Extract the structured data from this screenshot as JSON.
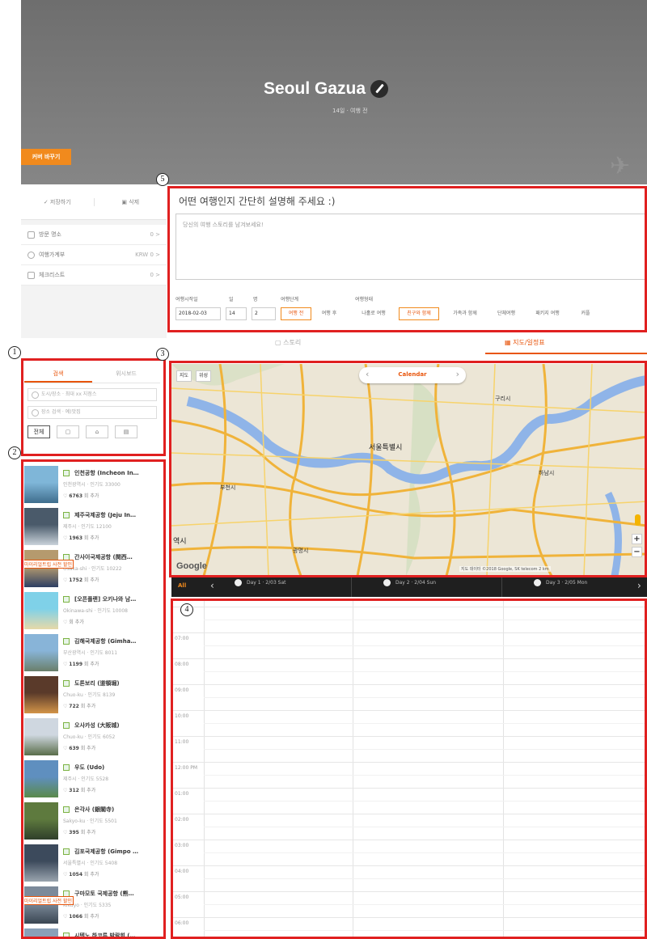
{
  "hero": {
    "title": "Seoul Gazua",
    "subtitle": "14일 · 여행 전",
    "cover_button": "커버 바꾸기"
  },
  "left_panel": {
    "save_button": "저장하기",
    "delete_button": "삭제",
    "menu": [
      {
        "label": "방문 명소",
        "count": "0 >"
      },
      {
        "label": "여행가계부",
        "count": "KRW 0 >"
      },
      {
        "label": "체크리스트",
        "count": "0 >"
      }
    ]
  },
  "search_panel": {
    "tabs": [
      "검색",
      "위시보드"
    ],
    "active_tab": 0,
    "city_placeholder": "도시/장소 · 최대 xx 지점스",
    "place_placeholder": "장소 검색 · 예)맛집",
    "filters": [
      "전체",
      "",
      "",
      ""
    ]
  },
  "places": [
    {
      "name": "인천공항 (Incheon In…",
      "sub": "인천광역시 · 인기도 33000",
      "count": "6763",
      "suffix": "회 추가",
      "colors": [
        "#7fb6d8",
        "#3f6d8c"
      ]
    },
    {
      "name": "제주국제공항 (Jeju In…",
      "sub": "제주시 · 인기도 12100",
      "count": "1963",
      "suffix": "회 추가",
      "colors": [
        "#4a5a6a",
        "#c9d2da"
      ]
    },
    {
      "name": "간사이국제공항 (関西…",
      "sub": "Osaka-shi · 인기도 10222",
      "count": "1752",
      "suffix": "회 추가",
      "tag": "마이리얼트립 사전 할인",
      "colors": [
        "#b59a6e",
        "#2d3f64"
      ]
    },
    {
      "name": "[오픈플랜] 오키나와 남…",
      "sub": "Okinawa-shi · 인기도 10008",
      "count": "",
      "suffix": "회 추가",
      "colors": [
        "#7fd1e8",
        "#e7d9a8"
      ]
    },
    {
      "name": "김해국제공항 (Gimha…",
      "sub": "부산광역시 · 인기도 8011",
      "count": "1199",
      "suffix": "회 추가",
      "colors": [
        "#88b4d8",
        "#6a7f6a"
      ]
    },
    {
      "name": "도톤보리 (道頓堀)",
      "sub": "Chuo-ku · 인기도 8139",
      "count": "722",
      "suffix": "회 추가",
      "colors": [
        "#5a3a2a",
        "#d29448"
      ]
    },
    {
      "name": "오사카성 (大阪城)",
      "sub": "Chuo-ku · 인기도 6052",
      "count": "639",
      "suffix": "회 추가",
      "colors": [
        "#cfd7e0",
        "#5a6e4a"
      ]
    },
    {
      "name": "우도 (Udo)",
      "sub": "제주시 · 인기도 5528",
      "count": "312",
      "suffix": "회 추가",
      "colors": [
        "#5f8fbf",
        "#5a8a4a"
      ]
    },
    {
      "name": "은각사 (銀閣寺)",
      "sub": "Sakyo-ku · 인기도 5501",
      "count": "395",
      "suffix": "회 추가",
      "colors": [
        "#5e7a3e",
        "#2f3f2a"
      ]
    },
    {
      "name": "김포국제공항 (Gimpo …",
      "sub": "서울특별시 · 인기도 5408",
      "count": "1054",
      "suffix": "회 추가",
      "colors": [
        "#3c4a5c",
        "#9aa4ae"
      ]
    },
    {
      "name": "구마모토 국제공항 (熊…",
      "sub": "Kikuyo · 인기도 5335",
      "count": "1066",
      "suffix": "회 추가",
      "tag": "마이리얼트립 사전 할인",
      "colors": [
        "#7c8a9a",
        "#3a4652"
      ]
    },
    {
      "name": "시텐노 하코루 박람회 (…",
      "sub": "",
      "count": "",
      "suffix": "",
      "colors": [
        "#8aa0b8",
        "#545454"
      ]
    }
  ],
  "description": {
    "title": "어떤 여행인지 간단히 설명해 주세요 :)",
    "placeholder": "당신의 여행 스토리를 남겨보세요!"
  },
  "trip_options": {
    "labels": {
      "start": "여행시작일",
      "days": "일",
      "people": "명",
      "stage": "여행단계",
      "type": "여행형태"
    },
    "start_date": "2018-02-03",
    "days": "14",
    "people": "2",
    "stage_options": [
      "여행 전",
      "여행 후"
    ],
    "stage_selected": 0,
    "type_options": [
      "나홀로 여행",
      "친구와 함께",
      "가족과 함께",
      "단체여행",
      "패키지 여행",
      "커플"
    ],
    "type_selected": 1
  },
  "view_tabs": [
    {
      "label": "스토리",
      "active": false
    },
    {
      "label": "지도/일정표",
      "active": true
    }
  ],
  "map": {
    "buttons": [
      "지도",
      "위성"
    ],
    "calendar_label": "Calendar",
    "labels": [
      {
        "text": "서울특별시",
        "big": true
      },
      {
        "text": "구리시",
        "big": false
      },
      {
        "text": "부천시",
        "big": false
      },
      {
        "text": "광명시",
        "big": false
      },
      {
        "text": "역시",
        "big": false
      },
      {
        "text": "하남시",
        "big": false
      }
    ],
    "attribution": "지도 데이터 ©2018 Google, SK telecom   2 km",
    "watermark": "Google"
  },
  "day_bar": {
    "all_label": "All",
    "days": [
      "Day 1 · 2/03 Sat",
      "Day 2 · 2/04 Sun",
      "Day 3 · 2/05 Mon"
    ]
  },
  "schedule": {
    "times": [
      "",
      "07:00",
      "08:00",
      "09:00",
      "10:00",
      "11:00",
      "12:00 PM",
      "01:00",
      "02:00",
      "03:00",
      "04:00",
      "05:00",
      "06:00"
    ]
  },
  "annotations": [
    "1",
    "2",
    "3",
    "4",
    "5"
  ],
  "colors": {
    "accent": "#e8550c",
    "accent_light": "#f18a1d",
    "annotation": "#e02020",
    "daybar": "#1f1f1f"
  }
}
